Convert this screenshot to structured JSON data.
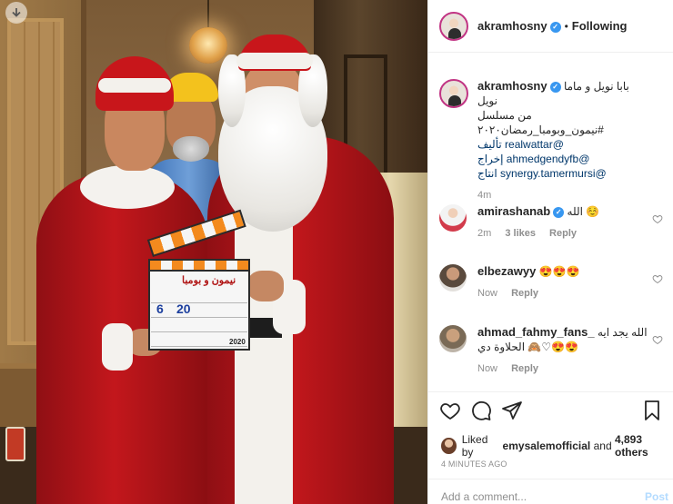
{
  "post": {
    "author": "akramhosny",
    "following_label": "Following",
    "dot": "•",
    "verified_mark": "✓",
    "caption": {
      "line1": "بابا نويل و ماما نويل",
      "line2": "من مسلسل #نيمون_وبومبا_رمضان٢٠٢٠",
      "line3": "@realwattar تأليف",
      "line4": "@ahmedgendyfb إخراج",
      "line5": "@synergy.tamermursi انتاج",
      "age": "4m"
    }
  },
  "comments": [
    {
      "user": "amirashanab",
      "verified": true,
      "text": "الله ☺️",
      "age": "2m",
      "likes": "3 likes",
      "reply": "Reply"
    },
    {
      "user": "elbezawyy",
      "verified": false,
      "text": "😍😍😍",
      "age": "Now",
      "reply": "Reply"
    },
    {
      "user": "ahmad_fahmy_fans_",
      "verified": false,
      "text": "الله يجد ايه 😍😍♡🙈 الحلاوة دي",
      "age": "Now",
      "reply": "Reply"
    }
  ],
  "likes": {
    "prefix": "Liked by",
    "user": "emysalemofficial",
    "and": "and",
    "count": "4,893 others"
  },
  "timestamp": "4 MINUTES AGO",
  "add_comment": {
    "placeholder": "Add a comment...",
    "post_label": "Post"
  },
  "clapperboard": {
    "title": "نيمون و بومبا",
    "scene": "6",
    "take": "20",
    "year": "2020"
  },
  "colors": {
    "link": "#00376b",
    "verified": "#3897f0",
    "muted": "#8e8e8e",
    "post_disabled": "#b3dbff"
  }
}
